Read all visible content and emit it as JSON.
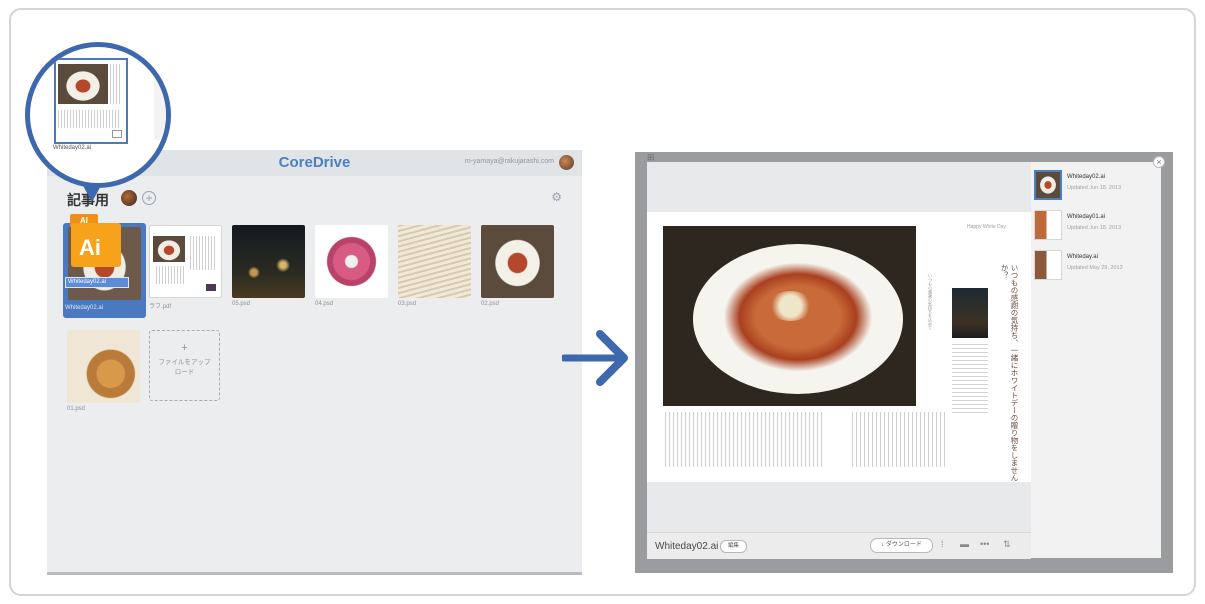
{
  "left_app": {
    "brand": "CoreDrive",
    "user_email": "m-yamaya@rakujarashi.com",
    "folder_title": "記事用",
    "add_symbol": "+",
    "settings_symbol": "⚙",
    "files": [
      {
        "name": "Whiteday02.ai",
        "kind": "ai-selected"
      },
      {
        "name": "ラフ.pdf",
        "kind": "layout"
      },
      {
        "name": "05.psd",
        "kind": "night"
      },
      {
        "name": "04.psd",
        "kind": "flower"
      },
      {
        "name": "03.psd",
        "kind": "menu"
      },
      {
        "name": "02.psd",
        "kind": "pasta"
      },
      {
        "name": "01.psd",
        "kind": "gratin"
      }
    ],
    "ai_tag": "AI",
    "ai_badge": "Ai",
    "upload_plus": "+",
    "upload_label": "ファイルをアップロード"
  },
  "magnifier": {
    "file_name": "Whiteday02.ai"
  },
  "right_app": {
    "doc_name": "Whiteday02.ai",
    "edit_label": "編集",
    "download_label": "↓ ダウンロード",
    "page_logo": "Happy White Day",
    "vertical_title": "いつもの感謝の気持ち、一緒にホワイトデーの贈り物をしませんか？",
    "vertical_small": "いつもの感謝の気持ちを込めて",
    "close_symbol": "×",
    "top_left_icons": "⊞",
    "sidebar": [
      {
        "name": "Whiteday02.ai",
        "date": "Updated Jun 18, 2013",
        "active": true
      },
      {
        "name": "Whiteday01.ai",
        "date": "Updated Jun 18, 2013",
        "active": false
      },
      {
        "name": "Whiteday.ai",
        "date": "Updated May 29, 2013",
        "active": false
      }
    ]
  },
  "colors": {
    "accent": "#4a7fc1",
    "magnifier_ring": "#3d68ad",
    "ai_orange": "#f7a21b",
    "arrow_blue": "#3d68ad"
  }
}
